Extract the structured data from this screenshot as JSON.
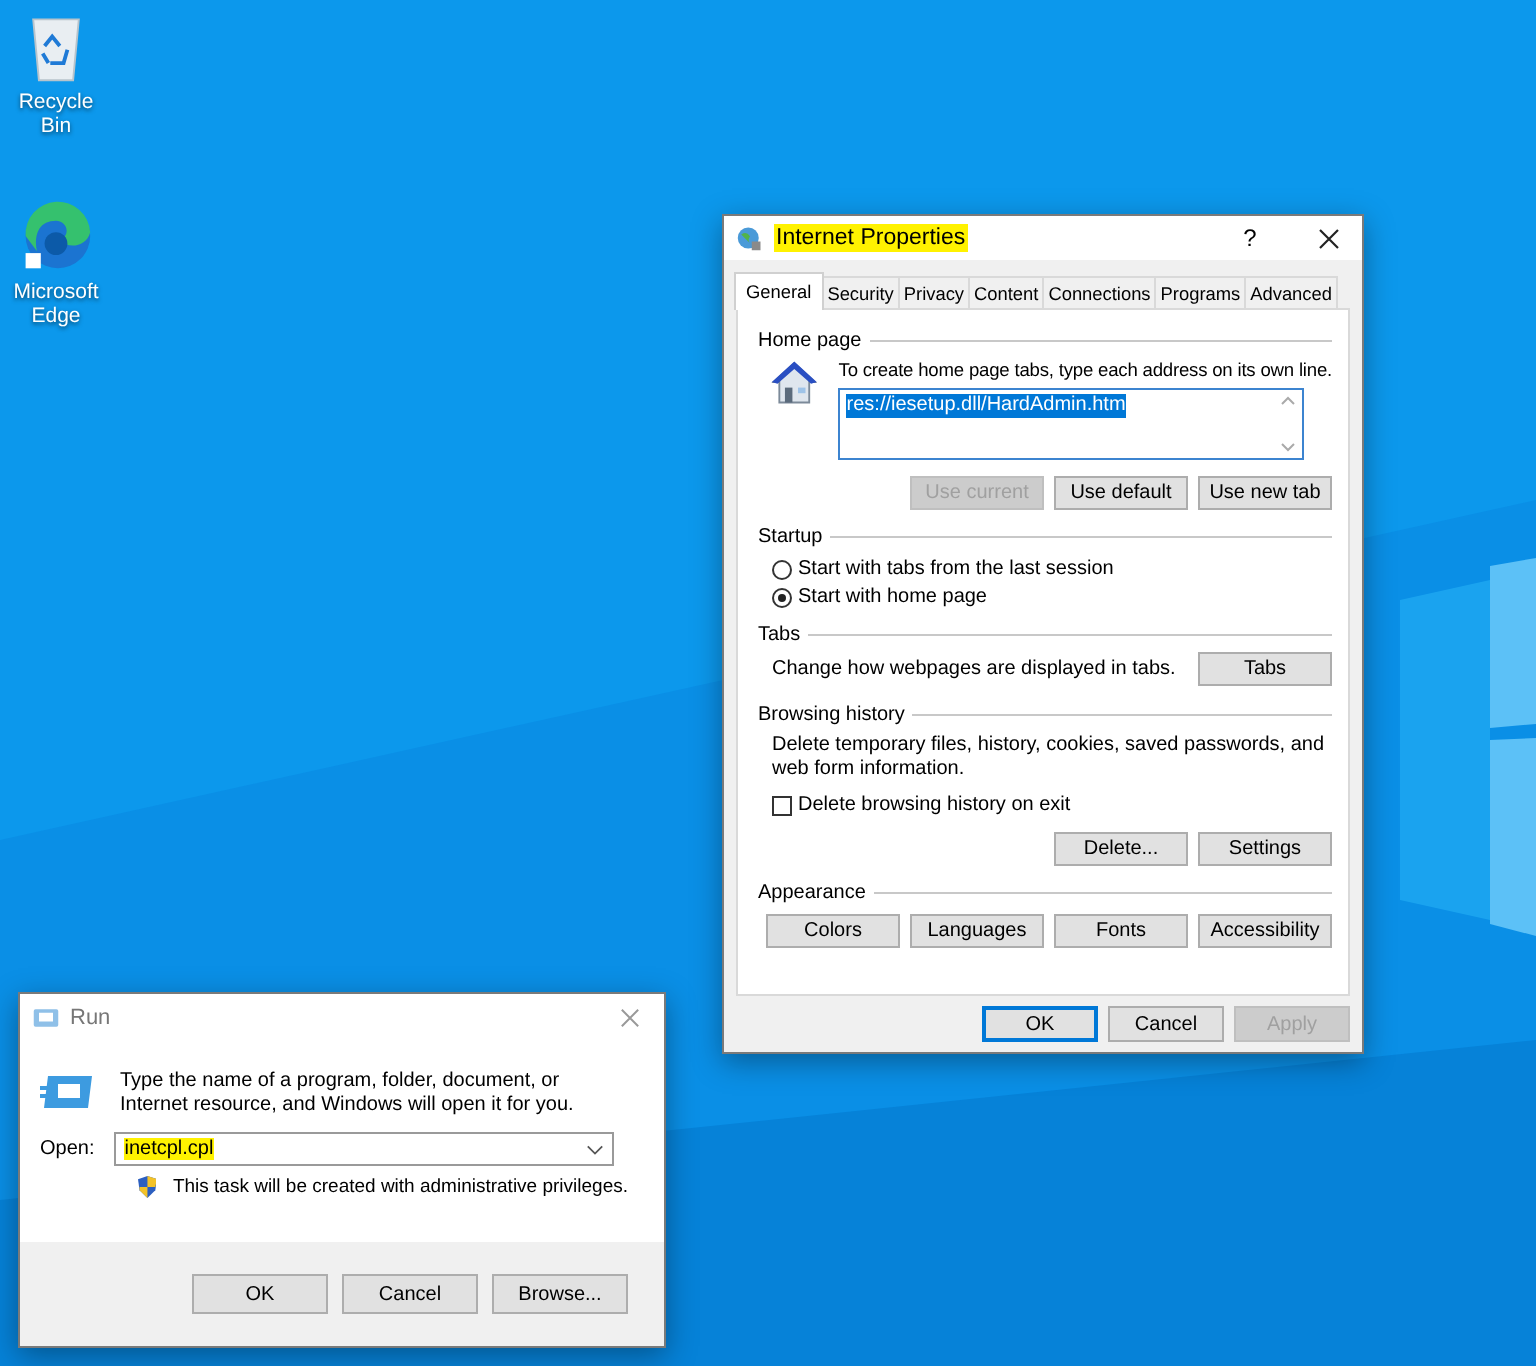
{
  "desktop_icons": [
    {
      "kind": "recycle",
      "label": "Recycle Bin"
    },
    {
      "kind": "edge",
      "label": "Microsoft Edge"
    }
  ],
  "internet_properties": {
    "title": "Internet Properties",
    "title_highlighted": true,
    "help": "?",
    "tabs": [
      {
        "label": "General",
        "selected": true
      },
      {
        "label": "Security",
        "selected": false
      },
      {
        "label": "Privacy",
        "selected": false
      },
      {
        "label": "Content",
        "selected": false
      },
      {
        "label": "Connections",
        "selected": false
      },
      {
        "label": "Programs",
        "selected": false
      },
      {
        "label": "Advanced",
        "selected": false
      }
    ],
    "home_page": {
      "heading": "Home page",
      "hint": "To create home page tabs, type each address on its own line.",
      "address": "res://iesetup.dll/HardAdmin.htm",
      "address_selected": true,
      "buttons": [
        {
          "label": "Use current",
          "disabled": true
        },
        {
          "label": "Use default",
          "disabled": false
        },
        {
          "label": "Use new tab",
          "disabled": false
        }
      ]
    },
    "startup": {
      "heading": "Startup",
      "options": [
        {
          "label": "Start with tabs from the last session",
          "selected": false
        },
        {
          "label": "Start with home page",
          "selected": true
        }
      ]
    },
    "tabs_section": {
      "heading": "Tabs",
      "text": "Change how webpages are displayed in tabs.",
      "button": "Tabs"
    },
    "browsing_history": {
      "heading": "Browsing history",
      "text": "Delete temporary files, history, cookies, saved passwords, and web form information.",
      "checkbox": {
        "label": "Delete browsing history on exit",
        "checked": false
      },
      "buttons": [
        "Delete...",
        "Settings"
      ]
    },
    "appearance": {
      "heading": "Appearance",
      "buttons": [
        "Colors",
        "Languages",
        "Fonts",
        "Accessibility"
      ]
    },
    "footer_buttons": [
      {
        "label": "OK",
        "default": true,
        "disabled": false
      },
      {
        "label": "Cancel",
        "default": false,
        "disabled": false
      },
      {
        "label": "Apply",
        "default": false,
        "disabled": true
      }
    ]
  },
  "run": {
    "title": "Run",
    "description": "Type the name of a program, folder, document, or Internet resource, and Windows will open it for you.",
    "open_label": "Open:",
    "value": "inetcpl.cpl",
    "value_highlighted": true,
    "admin_note": "This task will be created with administrative privileges.",
    "buttons": [
      "OK",
      "Cancel",
      "Browse..."
    ]
  }
}
